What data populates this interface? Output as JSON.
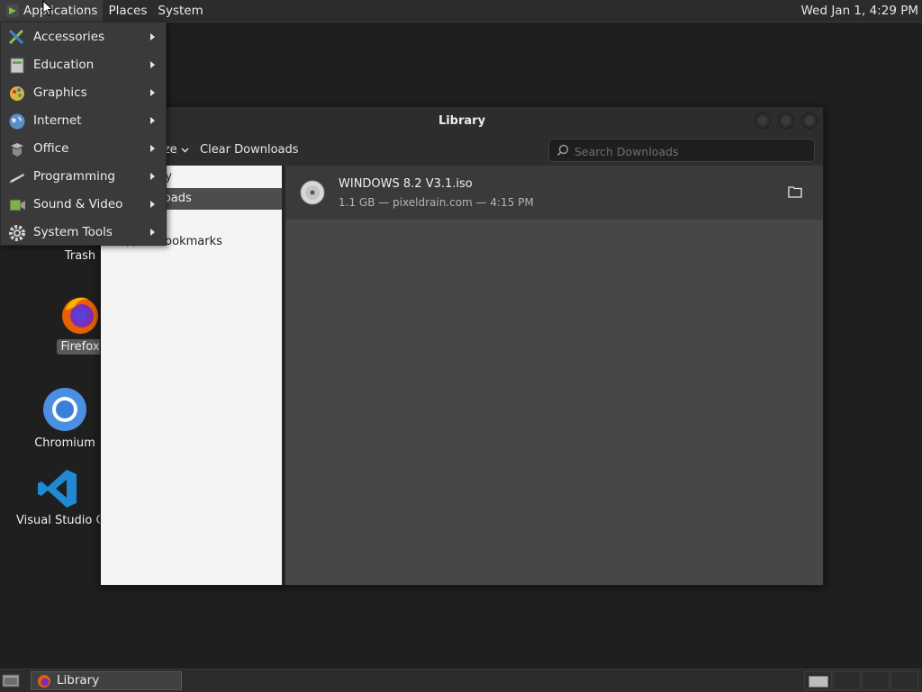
{
  "top_panel": {
    "menus": [
      "Applications",
      "Places",
      "System"
    ],
    "clock": "Wed Jan  1,  4:29 PM"
  },
  "app_menu": {
    "items": [
      {
        "label": "Accessories",
        "icon": "accessories-icon"
      },
      {
        "label": "Education",
        "icon": "education-icon"
      },
      {
        "label": "Graphics",
        "icon": "graphics-icon"
      },
      {
        "label": "Internet",
        "icon": "internet-icon"
      },
      {
        "label": "Office",
        "icon": "office-icon"
      },
      {
        "label": "Programming",
        "icon": "programming-icon"
      },
      {
        "label": "Sound & Video",
        "icon": "sound-video-icon"
      },
      {
        "label": "System Tools",
        "icon": "system-tools-icon"
      }
    ]
  },
  "desktop": {
    "icons": [
      {
        "label": "Trash"
      },
      {
        "label": "Firefox"
      },
      {
        "label": "Chromium"
      },
      {
        "label": "Visual Studio Co"
      }
    ]
  },
  "library": {
    "title": "Library",
    "toolbar": {
      "organize": "nize",
      "clear": "Clear Downloads"
    },
    "search_placeholder": "Search Downloads",
    "sidebar": [
      "ory",
      "nloads",
      "All Bookmarks"
    ],
    "download": {
      "name": "WINDOWS 8.2 V3.1.iso",
      "meta": "1.1 GB — pixeldrain.com — 4:15 PM"
    }
  },
  "taskbar": {
    "task": "Library"
  },
  "colors": {
    "panel": "#2c2c2c",
    "desktop": "#1f1f1f",
    "menu": "#3a3a3a",
    "content": "#474747"
  }
}
